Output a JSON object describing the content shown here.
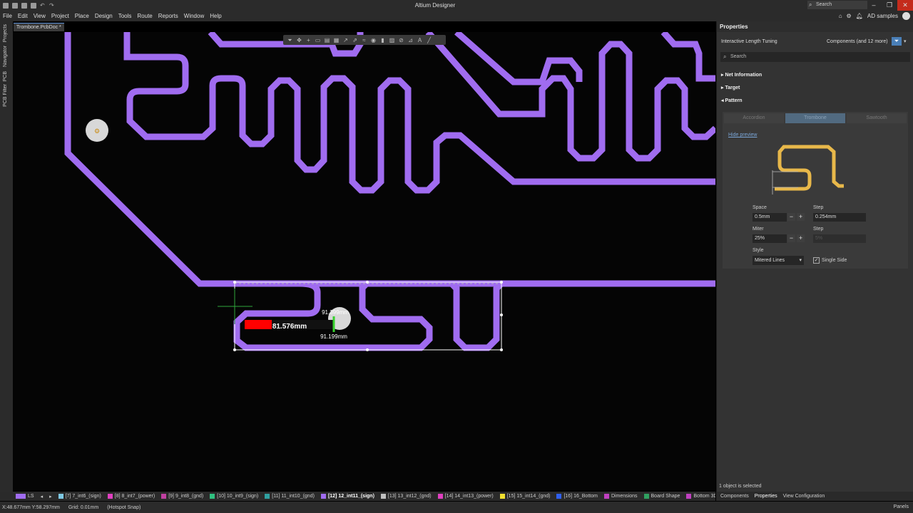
{
  "titlebar": {
    "title": "Altium Designer",
    "search_placeholder": "Search"
  },
  "menu": [
    "File",
    "Edit",
    "View",
    "Project",
    "Place",
    "Design",
    "Tools",
    "Route",
    "Reports",
    "Window",
    "Help"
  ],
  "account": {
    "workspace": "AD samples"
  },
  "left_tabs": [
    "Projects",
    "Navigator",
    "PCB",
    "PCB Filter"
  ],
  "document_tab": "Trombone.PcbDoc *",
  "canvas": {
    "length_value": "81.576mm",
    "target_top": "91.399mm",
    "target_bottom": "91.199mm",
    "trace_color": "#a06cf0",
    "progress_color": "#ff0000",
    "target_color": "#36d12c"
  },
  "properties": {
    "title": "Properties",
    "mode": "Interactive Length Tuning",
    "filter_scope": "Components (and 12 more)",
    "search_placeholder": "Search",
    "sections": {
      "net_info": "Net Information",
      "target": "Target",
      "pattern": "Pattern"
    },
    "pattern_types": [
      "Accordion",
      "Trombone",
      "Sawtooth"
    ],
    "pattern_selected": "Trombone",
    "hide_preview": "Hide preview",
    "space_label": "Space",
    "space_value": "0.5mm",
    "step_label": "Step",
    "step_value": "0.254mm",
    "miter_label": "Miter",
    "miter_value": "25%",
    "step2_label": "Step",
    "step2_value": "5%",
    "style_label": "Style",
    "style_value": "Mitered Lines",
    "single_side_label": "Single Side",
    "selection_info": "1 object is selected"
  },
  "layers": [
    {
      "label": "[7] 7_int6_(sign)",
      "color": "#7ec8e3"
    },
    {
      "label": "[8] 8_int7_(power)",
      "color": "#e040c0"
    },
    {
      "label": "[9] 9_int8_(gnd)",
      "color": "#c040a0"
    },
    {
      "label": "[10] 10_int9_(sign)",
      "color": "#30c080"
    },
    {
      "label": "[11] 11_int10_(gnd)",
      "color": "#30a0a0"
    },
    {
      "label": "[12] 12_int11_(sign)",
      "color": "#a06cf0"
    },
    {
      "label": "[13] 13_int12_(gnd)",
      "color": "#c0c0c0"
    },
    {
      "label": "[14] 14_int13_(power)",
      "color": "#e040c0"
    },
    {
      "label": "[15] 15_int14_(gnd)",
      "color": "#f0e030"
    },
    {
      "label": "[16] 16_Bottom",
      "color": "#3060f0"
    },
    {
      "label": "Dimensions",
      "color": "#c040c0"
    },
    {
      "label": "Board Shape",
      "color": "#30a060"
    },
    {
      "label": "Bottom 3D",
      "color": "#c040c0"
    }
  ],
  "layer_set": "LS",
  "active_layer": "[12] 12_int11_(sign)",
  "panel_tabs": [
    "Components",
    "Properties",
    "View Configuration"
  ],
  "status": {
    "coords": "X:48.677mm Y:58.297mm",
    "grid": "Grid: 0.01mm",
    "snap": "(Hotspot Snap)",
    "panels": "Panels"
  }
}
